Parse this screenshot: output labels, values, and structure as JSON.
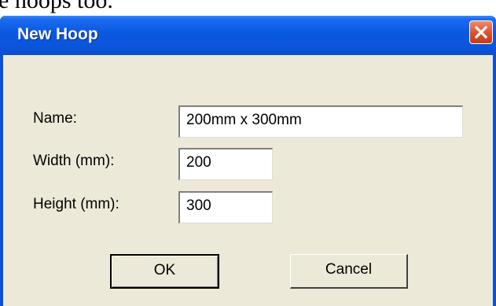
{
  "background_text": "e hoops too.",
  "dialog": {
    "title": "New Hoop",
    "close_icon": "close-icon",
    "colors": {
      "titlebar": "#0a58e0",
      "close_button": "#d9502b",
      "client": "#ece9d8"
    },
    "fields": {
      "name": {
        "label": "Name:",
        "value": "200mm x 300mm"
      },
      "width": {
        "label": "Width (mm):",
        "value": "200"
      },
      "height": {
        "label": "Height (mm):",
        "value": "300"
      }
    },
    "buttons": {
      "ok": "OK",
      "cancel": "Cancel"
    }
  }
}
